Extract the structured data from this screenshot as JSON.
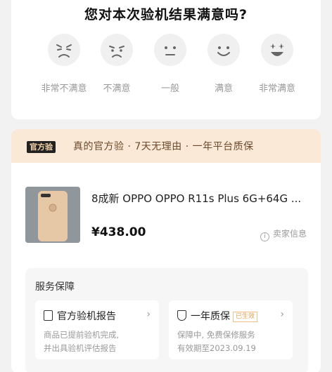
{
  "rating": {
    "title": "您对本次验机结果满意吗?",
    "options": [
      {
        "label": "非常不满意",
        "icon": "very-unhappy-face-icon"
      },
      {
        "label": "不满意",
        "icon": "unhappy-face-icon"
      },
      {
        "label": "一般",
        "icon": "neutral-face-icon"
      },
      {
        "label": "满意",
        "icon": "happy-face-icon"
      },
      {
        "label": "非常满意",
        "icon": "very-happy-face-icon"
      }
    ]
  },
  "banner": {
    "badge": "官方验",
    "text": "真的官方验 · 7天无理由 · 一年平台质保"
  },
  "product": {
    "title": "8成新 OPPO OPPO R11s Plus 6G+64G ...",
    "price": "¥438.00",
    "seller_label": "卖家信息"
  },
  "service": {
    "title": "服务保障",
    "items": [
      {
        "title": "官方验机报告",
        "tag": "",
        "desc_line1": "商品已提前验机完成,",
        "desc_line2": "并出具验机评估报告"
      },
      {
        "title": "一年质保",
        "tag": "已生效",
        "desc_line1": "保障中, 免费保修服务",
        "desc_line2": "有效期至2023.09.19"
      }
    ]
  },
  "colors": {
    "banner_bg": "#fbe9d7",
    "badge_bg": "#222222",
    "tag": "#e0a050"
  }
}
